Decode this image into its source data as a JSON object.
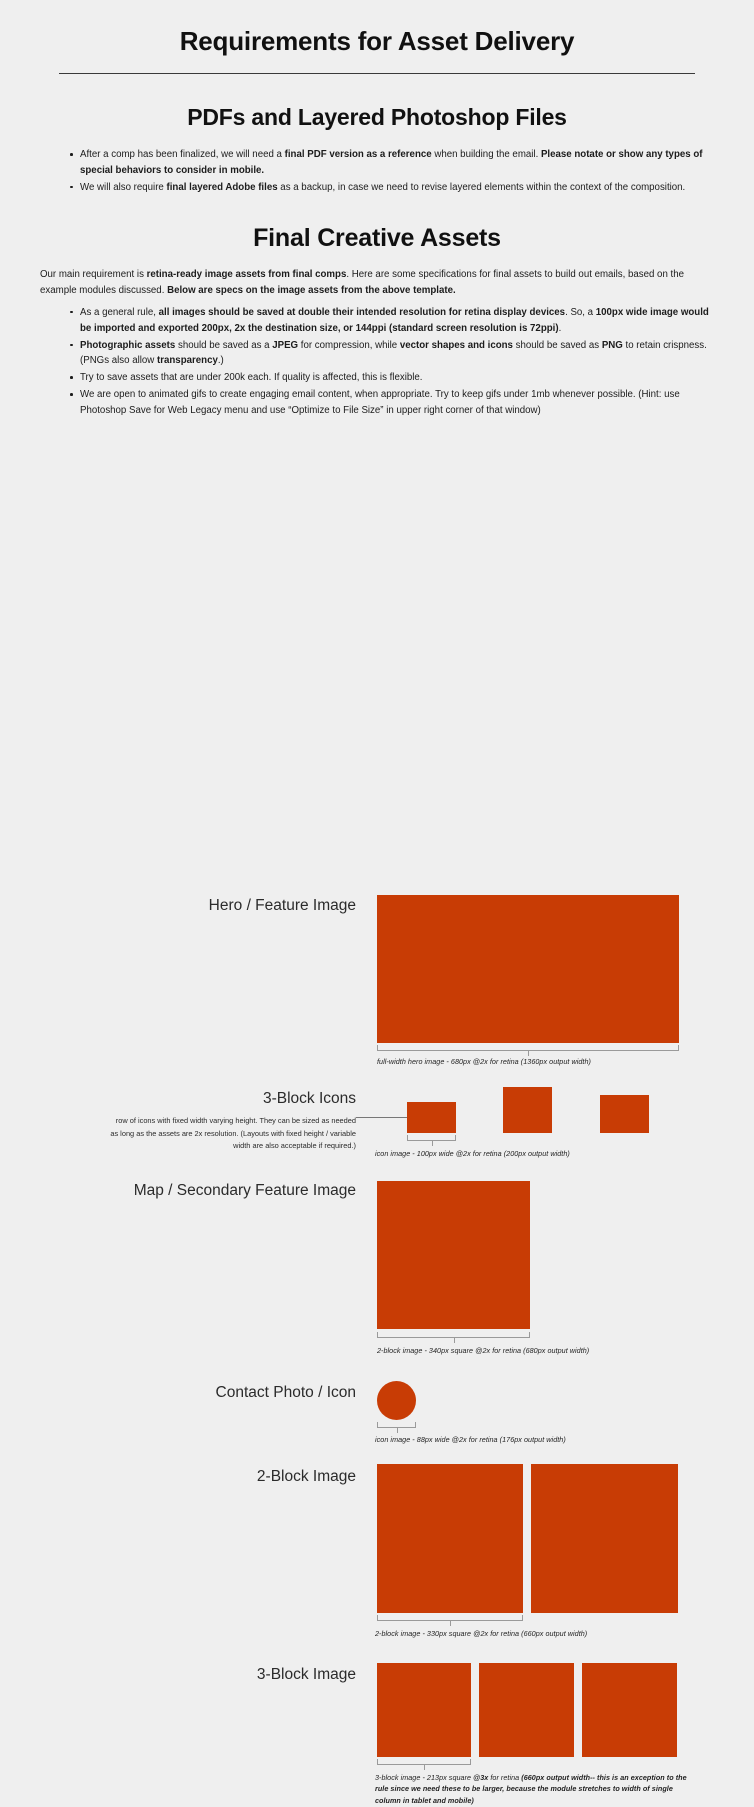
{
  "document": {
    "title": "Requirements for Asset Delivery"
  },
  "sections": [
    {
      "heading": "PDFs and Layered Photoshop Files",
      "bullets": [
        {
          "runs": [
            {
              "t": "After a comp has been finalized, we will need a ",
              "b": false
            },
            {
              "t": "final PDF version as a reference",
              "b": true
            },
            {
              "t": " when building the email. ",
              "b": false
            },
            {
              "t": "Please notate or show any types of special behaviors to consider in mobile.",
              "b": true
            }
          ]
        },
        {
          "runs": [
            {
              "t": "We will also require ",
              "b": false
            },
            {
              "t": "final layered Adobe files",
              "b": true
            },
            {
              "t": " as a backup, in case we need to revise layered elements within the context of the composition.",
              "b": false
            }
          ]
        }
      ]
    },
    {
      "heading": "Final Creative Assets",
      "intro": [
        {
          "t": "Our main requirement is ",
          "b": false
        },
        {
          "t": "retina-ready image assets from final comps",
          "b": true
        },
        {
          "t": ". Here are some specifications for final assets to build out emails, based on the example modules discussed. ",
          "b": false
        },
        {
          "t": "Below are specs on the image assets from the above template.",
          "b": true
        }
      ],
      "bullets": [
        {
          "runs": [
            {
              "t": "As a general rule, ",
              "b": false
            },
            {
              "t": "all images should be saved at double their intended resolution for retina display devices",
              "b": true
            },
            {
              "t": ". So, a ",
              "b": false
            },
            {
              "t": "100px wide image would be imported and exported 200px, 2x the destination size, or 144ppi (standard screen resolution is 72ppi)",
              "b": true
            },
            {
              "t": ".",
              "b": false
            }
          ]
        },
        {
          "runs": [
            {
              "t": "Photographic assets",
              "b": true
            },
            {
              "t": " should be saved as a ",
              "b": false
            },
            {
              "t": "JPEG",
              "b": true
            },
            {
              "t": " for compression, while ",
              "b": false
            },
            {
              "t": "vector shapes and icons",
              "b": true
            },
            {
              "t": " should be saved as ",
              "b": false
            },
            {
              "t": "PNG",
              "b": true
            },
            {
              "t": " to retain crispness. (PNGs also allow ",
              "b": false
            },
            {
              "t": "transparency",
              "b": true
            },
            {
              "t": ".)",
              "b": false
            }
          ]
        },
        {
          "runs": [
            {
              "t": "Try to save assets that are under 200k each. If quality is affected, this is flexible.",
              "b": false
            }
          ]
        },
        {
          "runs": [
            {
              "t": "We are open to animated gifs to create engaging email content, when appropriate. Try to keep gifs under 1mb whenever possible. (Hint: use Photoshop Save for Web Legacy menu and use “Optimize to File Size” in upper right corner of that window)",
              "b": false
            }
          ]
        }
      ]
    }
  ],
  "specs": {
    "hero": {
      "label": "Hero / Feature Image",
      "caption": "full-width hero image - 680px @2x for retina (1360px output width)"
    },
    "icons3": {
      "label": "3-Block Icons",
      "note": "row of icons with fixed width varying height. They can be sized as needed as long as the assets are 2x resolution. (Layouts with fixed height / variable width are also acceptable if required.)",
      "caption": "icon image - 100px wide  @2x for retina (200px output width)"
    },
    "map": {
      "label": "Map / Secondary Feature Image",
      "caption": "2-block image - 340px square @2x for retina (680px output width)"
    },
    "contact": {
      "label": "Contact Photo / Icon",
      "caption": "icon image - 88px wide  @2x for retina (176px output width)"
    },
    "block2": {
      "label": "2-Block Image",
      "caption": "2-block image - 330px square @2x for retina (660px output width)"
    },
    "block3": {
      "label": "3-Block Image",
      "caption_lead": "3-block image - 213px square ",
      "caption_bold": "@3x",
      "caption_rest": " for retina ",
      "caption_bold2": "(660px output width-- this is an exception to the rule since we need these to be larger, because the module stretches to width of single column in tablet and mobile)"
    }
  },
  "colors": {
    "placeholder": "#c83c05",
    "page_bg": "#efefef",
    "rule": "#3a3a3a",
    "bracket": "#9a9a9a"
  }
}
